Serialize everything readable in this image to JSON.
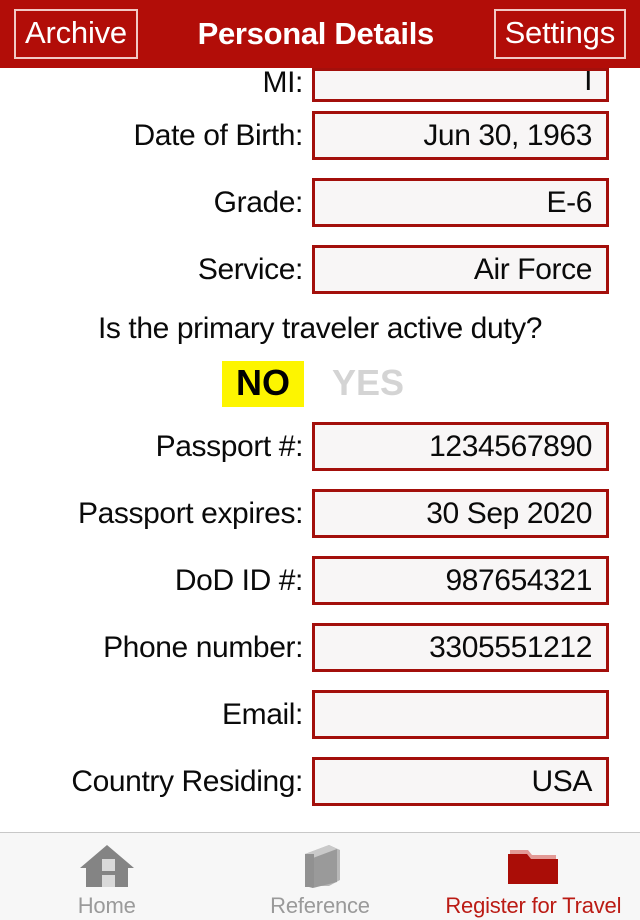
{
  "header": {
    "left_button": "Archive",
    "title": "Personal Details",
    "right_button": "Settings"
  },
  "form": {
    "rows": [
      {
        "label": "MI:",
        "value": "I",
        "clipped": true
      },
      {
        "label": "Date of Birth:",
        "value": "Jun 30, 1963"
      },
      {
        "label": "Grade:",
        "value": "E-6"
      },
      {
        "label": "Service:",
        "value": "Air Force"
      }
    ],
    "rows_after": [
      {
        "label": "Passport #:",
        "value": "1234567890"
      },
      {
        "label": "Passport expires:",
        "value": "30 Sep 2020"
      },
      {
        "label": "DoD ID #:",
        "value": "987654321"
      },
      {
        "label": "Phone number:",
        "value": "3305551212"
      },
      {
        "label": "Email:",
        "value": ""
      },
      {
        "label": "Country Residing:",
        "value": "USA"
      }
    ]
  },
  "active_duty": {
    "question": "Is the primary traveler active duty?",
    "option_no": "NO",
    "option_yes": "YES",
    "selected": "NO",
    "highlight_color": "#fdf500"
  },
  "tabbar": {
    "tabs": [
      {
        "label": "Home",
        "icon": "home-icon",
        "active": false
      },
      {
        "label": "Reference",
        "icon": "book-icon",
        "active": false
      },
      {
        "label": "Register for Travel",
        "icon": "folder-icon",
        "active": true
      }
    ]
  },
  "colors": {
    "header_red": "#b20d08",
    "border_red": "#a30f0b",
    "active_tab_red": "#bb1b14",
    "field_fill": "#f8f6f6"
  }
}
